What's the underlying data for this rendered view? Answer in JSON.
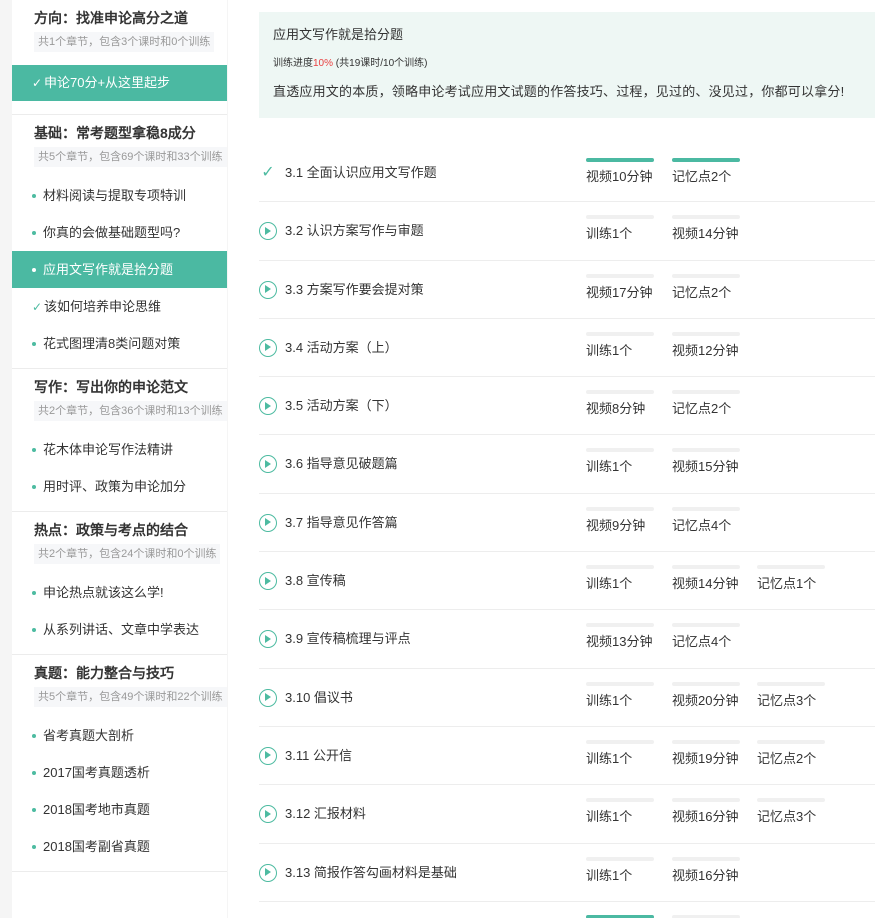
{
  "sidebar": {
    "sections": [
      {
        "title": "方向：找准申论高分之道",
        "sub": "共1个章节，包含3个课时和0个训练",
        "items": [
          {
            "label": "申论70分+从这里起步",
            "state": "active-check"
          }
        ]
      },
      {
        "title": "基础：常考题型拿稳8成分",
        "sub": "共5个章节，包含69个课时和33个训练",
        "items": [
          {
            "label": "材料阅读与提取专项特训",
            "state": "dot"
          },
          {
            "label": "你真的会做基础题型吗?",
            "state": "dot"
          },
          {
            "label": "应用文写作就是拾分题",
            "state": "active-dot"
          },
          {
            "label": "该如何培养申论思维",
            "state": "check"
          },
          {
            "label": "花式图理清8类问题对策",
            "state": "dot"
          }
        ]
      },
      {
        "title": "写作：写出你的申论范文",
        "sub": "共2个章节，包含36个课时和13个训练",
        "items": [
          {
            "label": "花木体申论写作法精讲",
            "state": "dot"
          },
          {
            "label": "用时评、政策为申论加分",
            "state": "dot"
          }
        ]
      },
      {
        "title": "热点：政策与考点的结合",
        "sub": "共2个章节，包含24个课时和0个训练",
        "items": [
          {
            "label": "申论热点就该这么学!",
            "state": "dot"
          },
          {
            "label": "从系列讲话、文章中学表达",
            "state": "dot"
          }
        ]
      },
      {
        "title": "真题：能力整合与技巧",
        "sub": "共5个章节，包含49个课时和22个训练",
        "items": [
          {
            "label": "省考真题大剖析",
            "state": "dot"
          },
          {
            "label": "2017国考真题透析",
            "state": "dot"
          },
          {
            "label": "2018国考地市真题",
            "state": "dot"
          },
          {
            "label": "2018国考副省真题",
            "state": "dot"
          }
        ]
      }
    ]
  },
  "banner": {
    "title": "应用文写作就是拾分题",
    "progress_label": "训练进度",
    "progress_pct": "10%",
    "progress_detail": "(共19课时/10个训练)",
    "desc": "直透应用文的本质，领略申论考试应用文试题的作答技巧、过程，见过的、没见过，你都可以拿分!"
  },
  "colors": {
    "accent": "#4bb9a2",
    "progress": "#e94040",
    "banner_bg": "#eef7f4"
  },
  "lessons": [
    {
      "title": "3.1 全面认识应用文写作题",
      "icon": "check-icon",
      "tags": [
        {
          "label": "视频10分钟",
          "progress": 1.0
        },
        {
          "label": "记忆点2个",
          "progress": 1.0
        }
      ]
    },
    {
      "title": "3.2 认识方案写作与审题",
      "icon": "play-icon",
      "tags": [
        {
          "label": "训练1个",
          "progress": 0
        },
        {
          "label": "视频14分钟",
          "progress": 0
        }
      ]
    },
    {
      "title": "3.3 方案写作要会提对策",
      "icon": "play-icon",
      "tags": [
        {
          "label": "视频17分钟",
          "progress": 0
        },
        {
          "label": "记忆点2个",
          "progress": 0
        }
      ]
    },
    {
      "title": "3.4 活动方案（上）",
      "icon": "play-icon",
      "tags": [
        {
          "label": "训练1个",
          "progress": 0
        },
        {
          "label": "视频12分钟",
          "progress": 0
        }
      ]
    },
    {
      "title": "3.5 活动方案（下）",
      "icon": "play-icon",
      "tags": [
        {
          "label": "视频8分钟",
          "progress": 0
        },
        {
          "label": "记忆点2个",
          "progress": 0
        }
      ]
    },
    {
      "title": "3.6 指导意见破题篇",
      "icon": "play-icon",
      "tags": [
        {
          "label": "训练1个",
          "progress": 0
        },
        {
          "label": "视频15分钟",
          "progress": 0
        }
      ]
    },
    {
      "title": "3.7 指导意见作答篇",
      "icon": "play-icon",
      "tags": [
        {
          "label": "视频9分钟",
          "progress": 0
        },
        {
          "label": "记忆点4个",
          "progress": 0
        }
      ]
    },
    {
      "title": "3.8 宣传稿",
      "icon": "play-icon",
      "tags": [
        {
          "label": "训练1个",
          "progress": 0
        },
        {
          "label": "视频14分钟",
          "progress": 0
        },
        {
          "label": "记忆点1个",
          "progress": 0
        }
      ]
    },
    {
      "title": "3.9 宣传稿梳理与评点",
      "icon": "play-icon",
      "tags": [
        {
          "label": "视频13分钟",
          "progress": 0
        },
        {
          "label": "记忆点4个",
          "progress": 0
        }
      ]
    },
    {
      "title": "3.10 倡议书",
      "icon": "play-icon",
      "tags": [
        {
          "label": "训练1个",
          "progress": 0
        },
        {
          "label": "视频20分钟",
          "progress": 0
        },
        {
          "label": "记忆点3个",
          "progress": 0
        }
      ]
    },
    {
      "title": "3.11 公开信",
      "icon": "play-icon",
      "tags": [
        {
          "label": "训练1个",
          "progress": 0
        },
        {
          "label": "视频19分钟",
          "progress": 0
        },
        {
          "label": "记忆点2个",
          "progress": 0
        }
      ]
    },
    {
      "title": "3.12 汇报材料",
      "icon": "play-icon",
      "tags": [
        {
          "label": "训练1个",
          "progress": 0
        },
        {
          "label": "视频16分钟",
          "progress": 0
        },
        {
          "label": "记忆点3个",
          "progress": 0
        }
      ]
    },
    {
      "title": "3.13 简报作答勾画材料是基础",
      "icon": "play-icon",
      "tags": [
        {
          "label": "训练1个",
          "progress": 0
        },
        {
          "label": "视频16分钟",
          "progress": 0
        }
      ]
    },
    {
      "title": "",
      "icon": "",
      "tags": [
        {
          "label": "",
          "progress": 1.0
        },
        {
          "label": "",
          "progress": 0
        }
      ]
    }
  ]
}
